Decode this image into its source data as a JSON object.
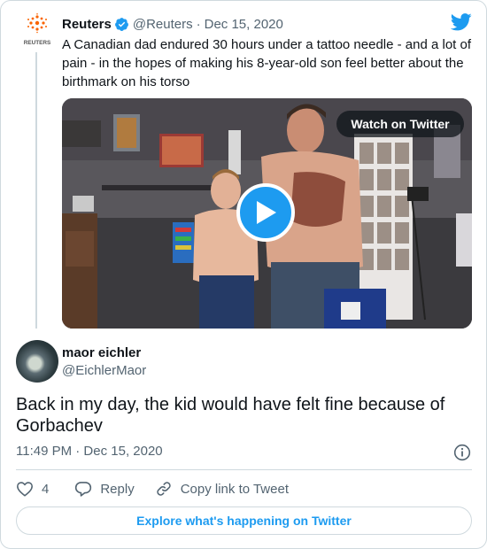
{
  "quoted_tweet": {
    "author_name": "Reuters",
    "author_handle": "@Reuters",
    "separator": "·",
    "date": "Dec 15, 2020",
    "logo_text": "REUTERS",
    "text": "A Canadian dad endured 30 hours under a tattoo needle - and a lot of pain - in the hopes of making his 8-year-old son feel better about the birthmark on his torso",
    "media": {
      "watch_label": "Watch on Twitter",
      "play_icon": "play-icon"
    }
  },
  "tweet": {
    "author_name": "maor eichler",
    "author_handle": "@EichlerMaor",
    "text": "Back in my day, the kid would have felt fine because of Gorbachev",
    "timestamp": "11:49 PM · Dec 15, 2020"
  },
  "actions": {
    "like_count": "4",
    "reply_label": "Reply",
    "copy_link_label": "Copy link to Tweet"
  },
  "explore_label": "Explore what's happening on Twitter",
  "colors": {
    "accent": "#1d9bf0",
    "text_primary": "#0f1419",
    "text_secondary": "#536471",
    "border": "#cfd9de",
    "reuters_orange": "#fa6400"
  }
}
